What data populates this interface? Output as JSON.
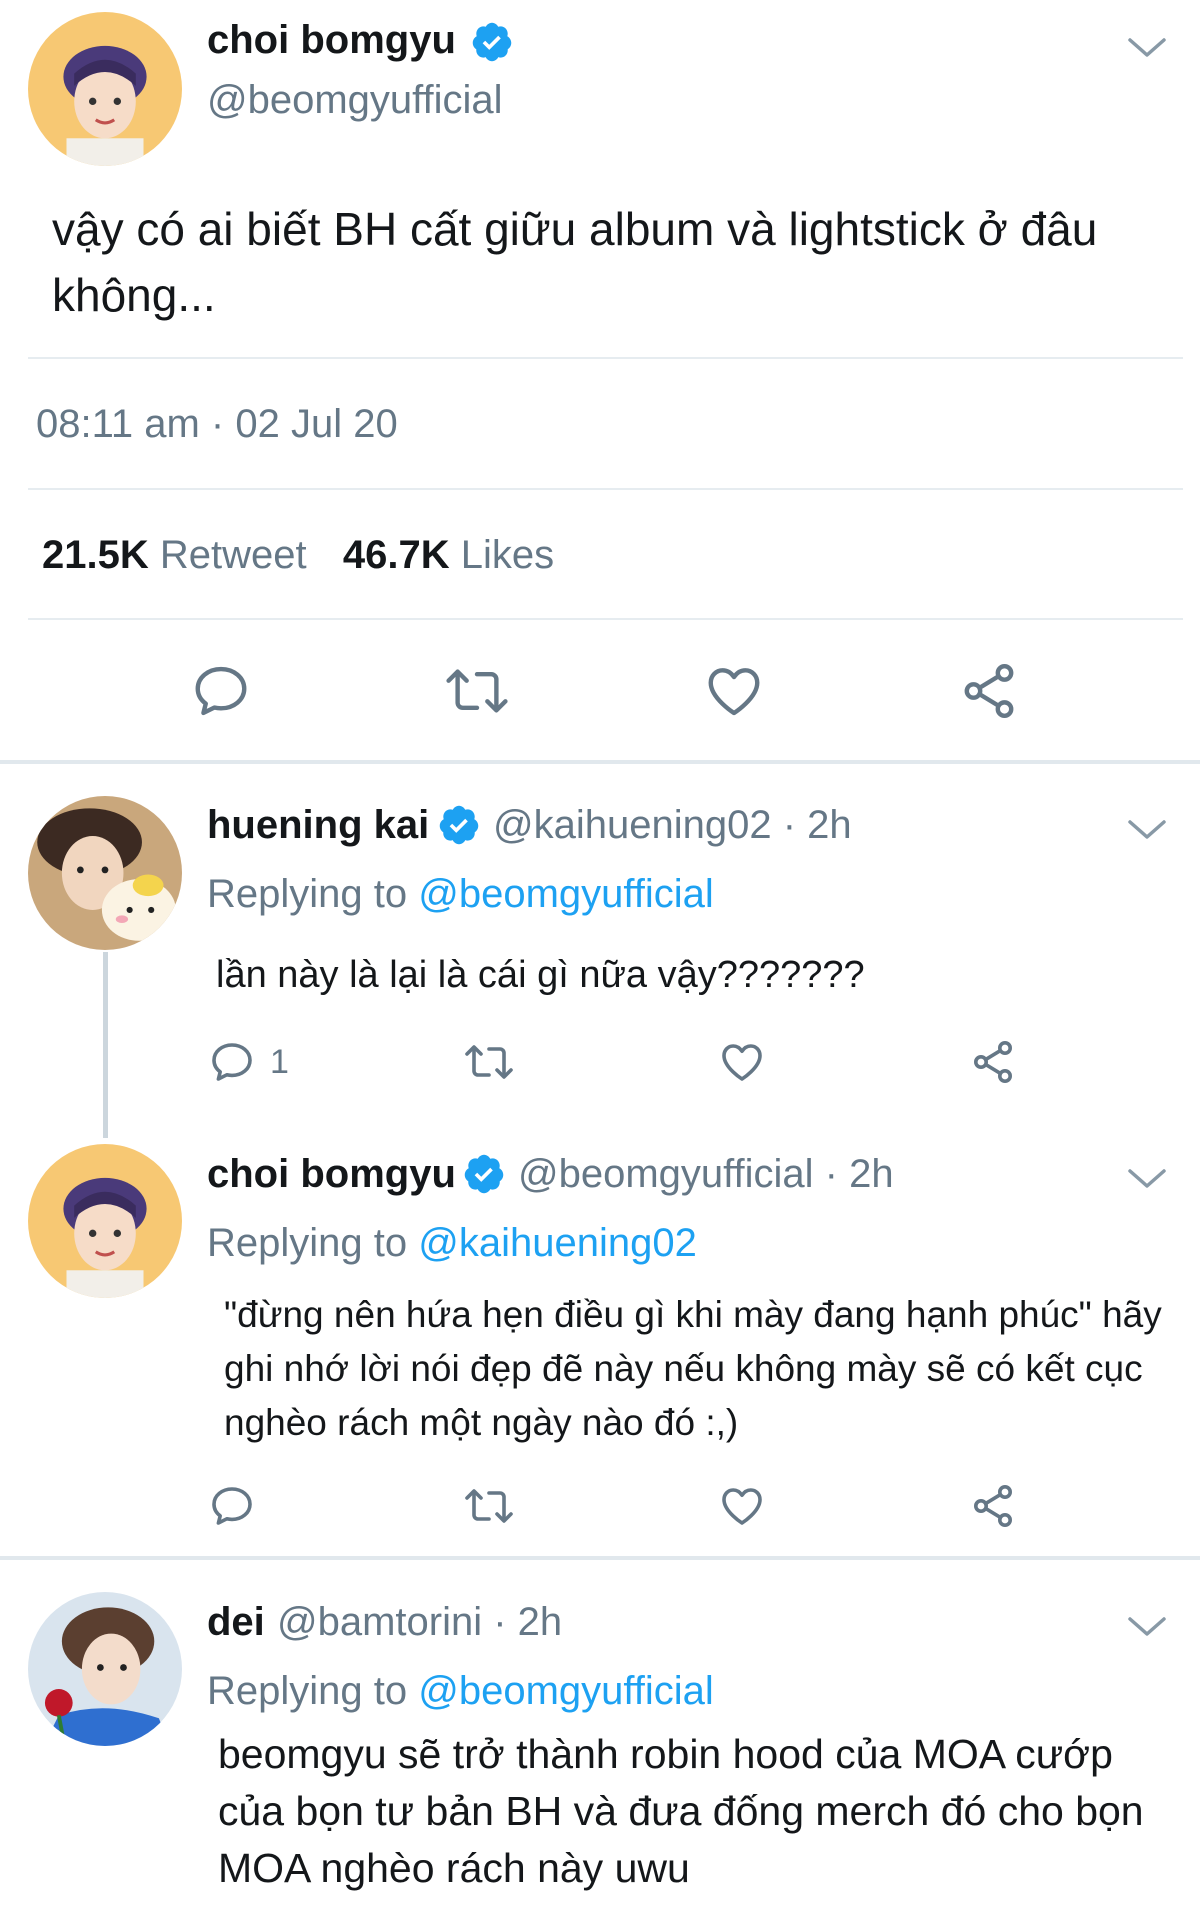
{
  "main_tweet": {
    "name": "choi bomgyu",
    "handle": "@beomgyufficial",
    "text": "vậy có ai biết BH cất giữu album và lightstick ở đâu không...",
    "time": "08:11 am · 02 Jul 20",
    "retweets_count": "21.5K",
    "retweets_label": "Retweet",
    "likes_count": "46.7K",
    "likes_label": "Likes"
  },
  "replies": [
    {
      "name": "huening kai",
      "handle": "@kaihuening02 · 2h",
      "replying_label": "Replying to",
      "replying_handle": "@beomgyufficial",
      "text": "lần này là lại là cái gì nữa vậy???????",
      "reply_count": "1"
    },
    {
      "name": "choi bomgyu",
      "handle": "@beomgyufficial · 2h",
      "replying_label": "Replying to",
      "replying_handle": "@kaihuening02",
      "text": "\"đừng nên hứa hẹn điều gì khi mày đang hạnh phúc\" hãy ghi nhớ lời nói đẹp đẽ này nếu không mày sẽ có kết cục nghèo rách một ngày nào đó :,)"
    },
    {
      "name": "dei",
      "handle": "@bamtorini · 2h",
      "replying_label": "Replying to",
      "replying_handle": "@beomgyufficial",
      "text": "beomgyu sẽ trở thành robin hood của MOA cướp của bọn tư bản BH và đưa đống merch đó cho bọn MOA nghèo rách này uwu"
    }
  ],
  "colors": {
    "accent": "#1da1f2",
    "muted": "#657786",
    "divider": "#e6ecf0"
  },
  "icons": [
    "verified-badge-icon",
    "chevron-down-icon",
    "reply-icon",
    "retweet-icon",
    "like-icon",
    "share-icon"
  ]
}
